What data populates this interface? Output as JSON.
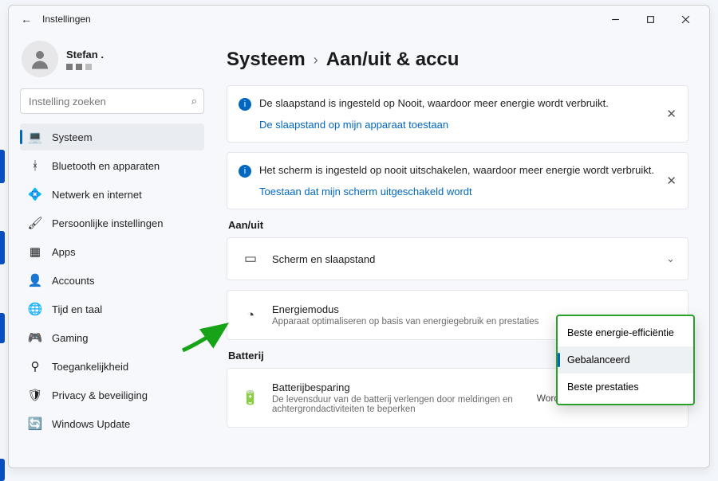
{
  "titlebar": {
    "back_icon": "←",
    "title": "Instellingen"
  },
  "profile": {
    "name": "Stefan ."
  },
  "search": {
    "placeholder": "Instelling zoeken"
  },
  "sidebar": {
    "items": [
      {
        "icon": "💻",
        "label": "Systeem",
        "active": true
      },
      {
        "icon": "ᚼ",
        "label": "Bluetooth en apparaten"
      },
      {
        "icon": "💠",
        "label": "Netwerk en internet"
      },
      {
        "icon": "🖌",
        "label": "Persoonlijke instellingen"
      },
      {
        "icon": "▦",
        "label": "Apps"
      },
      {
        "icon": "👤",
        "label": "Accounts"
      },
      {
        "icon": "🌐",
        "label": "Tijd en taal"
      },
      {
        "icon": "🎮",
        "label": "Gaming"
      },
      {
        "icon": "⚲",
        "label": "Toegankelijkheid"
      },
      {
        "icon": "🛡",
        "label": "Privacy & beveiliging"
      },
      {
        "icon": "🔄",
        "label": "Windows Update"
      }
    ]
  },
  "crumbs": {
    "root": "Systeem",
    "sep": "›",
    "leaf": "Aan/uit & accu"
  },
  "alerts": [
    {
      "text": "De slaapstand is ingesteld op Nooit, waardoor meer energie wordt verbruikt.",
      "link": "De slaapstand op mijn apparaat toestaan"
    },
    {
      "text": "Het scherm is ingesteld op nooit uitschakelen, waardoor meer energie wordt verbruikt.",
      "link": "Toestaan dat mijn scherm uitgeschakeld wordt"
    }
  ],
  "sections": {
    "power": {
      "title": "Aan/uit",
      "rows": {
        "screen": {
          "title": "Scherm en slaapstand"
        },
        "mode": {
          "title": "Energiemodus",
          "sub": "Apparaat optimaliseren op basis van energiegebruik en prestaties"
        }
      }
    },
    "battery": {
      "title": "Batterij",
      "rows": {
        "saver": {
          "title": "Batterijbesparing",
          "sub": "De levensduur van de batterij verlengen door meldingen en achtergrondactiviteiten te beperken",
          "right": "Wordt om 20% ingeschakeld"
        }
      }
    }
  },
  "popup": {
    "items": [
      {
        "label": "Beste energie-efficiëntie"
      },
      {
        "label": "Gebalanceerd",
        "selected": true
      },
      {
        "label": "Beste prestaties"
      }
    ]
  }
}
